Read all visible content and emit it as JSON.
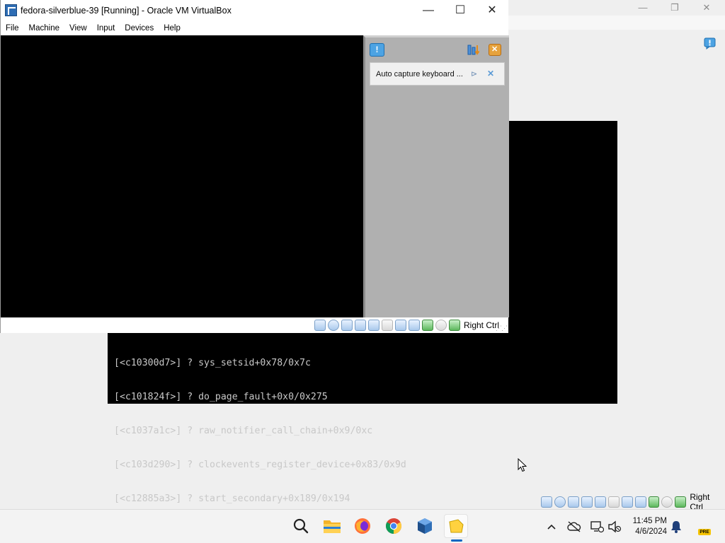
{
  "background_vm": {
    "console_lines": [
      "[<c10300d7>] ? sys_setsid+0x78/0x7c",
      "[<c101824f>] ? do_page_fault+0x0/0x275",
      "[<c1037a1c>] ? raw_notifier_call_chain+0x9/0xc",
      "[<c103d290>] ? clockevents_register_device+0x83/0x9d",
      "[<c12885a3>] ? start_secondary+0x189/0x194"
    ],
    "host_key_label": "Right Ctrl"
  },
  "window": {
    "title": "fedora-silverblue-39 [Running] - Oracle VM VirtualBox",
    "menu": [
      "File",
      "Machine",
      "View",
      "Input",
      "Devices",
      "Help"
    ],
    "host_key_label": "Right Ctrl"
  },
  "notification_center": {
    "message": "Auto capture keyboard ..."
  },
  "taskbar": {
    "apps": [
      "search-icon",
      "file-explorer-icon",
      "firefox-icon",
      "chrome-icon",
      "virtualbox-icon",
      "sticky-app-icon"
    ],
    "time": "11:45 PM",
    "date": "4/6/2024",
    "badge": "PRE"
  },
  "colors": {
    "accent": "#0a66c2",
    "vm_screen": "#000000",
    "notification_pane": "#b0b0b0"
  }
}
